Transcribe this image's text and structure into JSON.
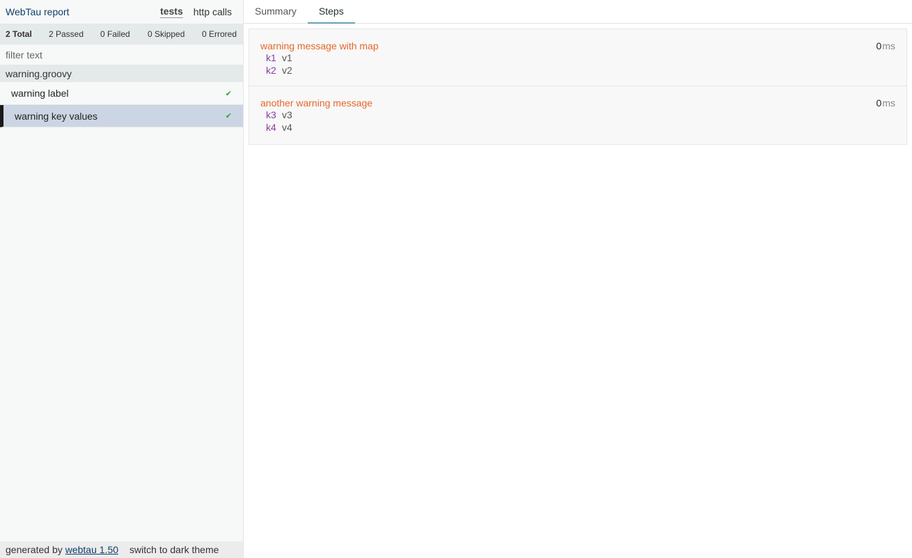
{
  "sidebar": {
    "title": "WebTau report",
    "tabs": {
      "tests": "tests",
      "http_calls": "http calls"
    },
    "summary": {
      "total": "2 Total",
      "passed": "2 Passed",
      "failed": "0 Failed",
      "skipped": "0 Skipped",
      "errored": "0 Errored"
    },
    "filter": {
      "placeholder": "filter text",
      "value": ""
    },
    "group": "warning.groovy",
    "tests": [
      {
        "label": "warning label",
        "status": "✔"
      },
      {
        "label": "warning key values",
        "status": "✔"
      }
    ],
    "footer": {
      "generated_by": "generated by",
      "link": "webtau 1.50",
      "theme_toggle": "switch to dark theme"
    }
  },
  "main": {
    "tabs": [
      "Summary",
      "Steps"
    ],
    "active_tab": "Steps",
    "steps": [
      {
        "message": "warning message with map",
        "time": "0",
        "unit": "ms",
        "kv": [
          {
            "k": "k1",
            "v": "v1"
          },
          {
            "k": "k2",
            "v": "v2"
          }
        ]
      },
      {
        "message": "another warning message",
        "time": "0",
        "unit": "ms",
        "kv": [
          {
            "k": "k3",
            "v": "v3"
          },
          {
            "k": "k4",
            "v": "v4"
          }
        ]
      }
    ]
  },
  "colors": {
    "accent": "#6a9fb6",
    "warning_text": "#e4672b",
    "key_text": "#8a3fa0",
    "pass": "#2ba52b",
    "selected_row": "#ccd5e4"
  }
}
